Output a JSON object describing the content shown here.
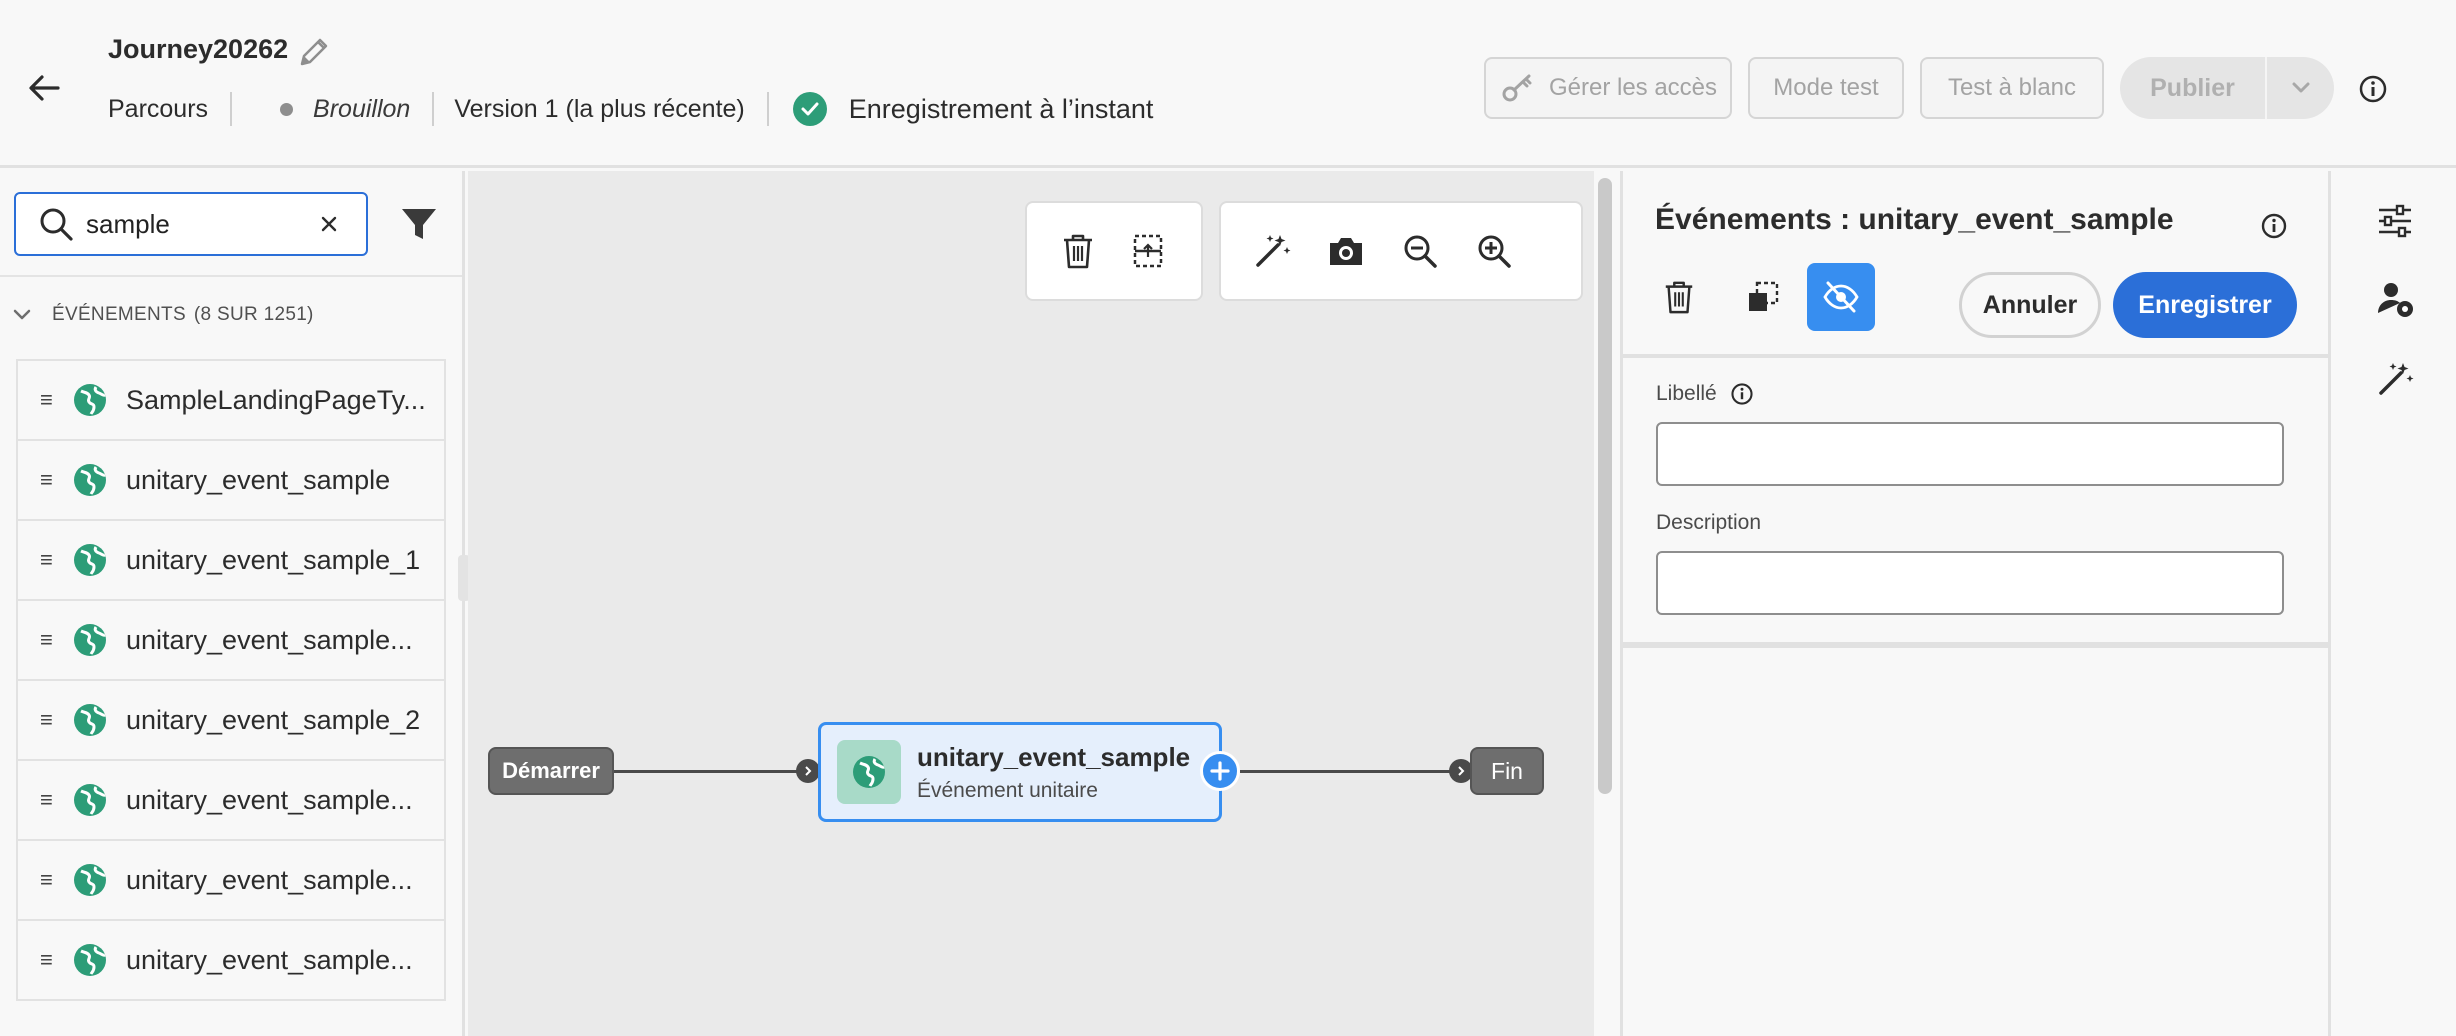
{
  "header": {
    "journey_title": "Journey20262",
    "breadcrumb": "Parcours",
    "status": "Brouillon",
    "version": "Version 1 (la plus récente)",
    "save_status": "Enregistrement à l’instant",
    "manage_access": "Gérer les accès",
    "test_mode": "Mode test",
    "dry_run": "Test à blanc",
    "publish": "Publier"
  },
  "left_panel": {
    "search_value": "sample",
    "section_label": "ÉVÉNEMENTS",
    "section_count": "(8 SUR 1251)",
    "events": [
      "SampleLandingPageTy...",
      "unitary_event_sample",
      "unitary_event_sample_1",
      "unitary_event_sample...",
      "unitary_event_sample_2",
      "unitary_event_sample...",
      "unitary_event_sample...",
      "unitary_event_sample..."
    ]
  },
  "canvas": {
    "start_label": "Démarrer",
    "event_node_title": "unitary_event_sample",
    "event_node_subtitle": "Événement unitaire",
    "end_label": "Fin"
  },
  "right_panel": {
    "title": "Événements : unitary_event_sample",
    "cancel": "Annuler",
    "save": "Enregistrer",
    "label_field": "Libellé",
    "label_value": "",
    "description_field": "Description",
    "description_value": ""
  },
  "colors": {
    "accent": "#2b6fd8",
    "success": "#2d9d78",
    "node_fill": "#e5effc",
    "node_border": "#378ef0"
  },
  "icons": [
    "back-arrow-icon",
    "pencil-icon",
    "check-circle-icon",
    "key-icon",
    "chevron-down-icon",
    "info-icon",
    "search-icon",
    "close-icon",
    "filter-icon",
    "chevron-down-icon",
    "drag-handle-icon",
    "globe-icon",
    "trash-icon",
    "select-cells-icon",
    "magic-wand-icon",
    "camera-icon",
    "zoom-out-icon",
    "zoom-in-icon",
    "plus-icon",
    "copy-icon",
    "eye-off-icon",
    "settings-sliders-icon",
    "user-settings-icon"
  ]
}
